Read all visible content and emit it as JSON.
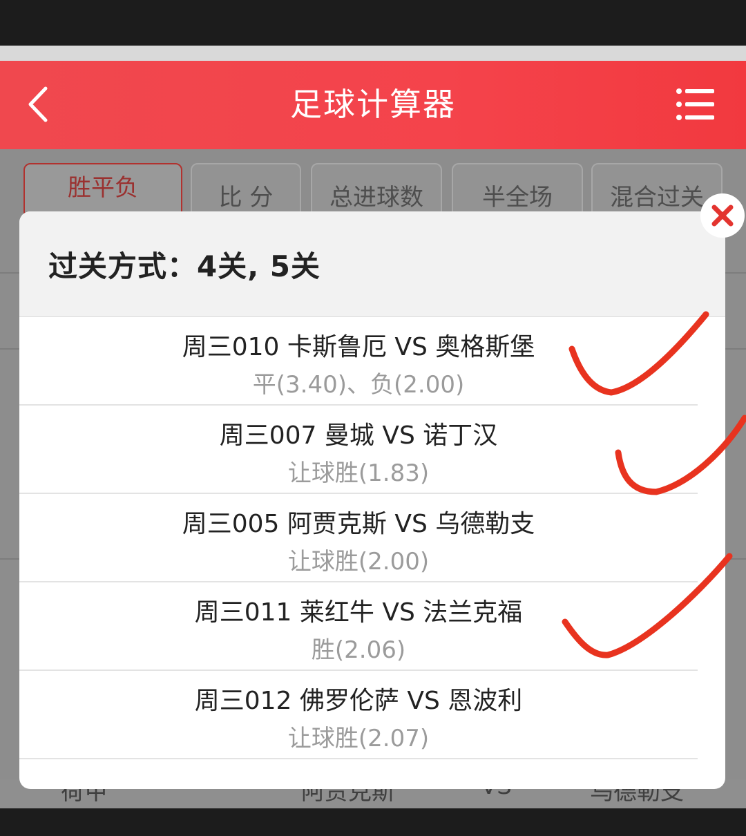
{
  "header": {
    "title": "足球计算器"
  },
  "tabs": [
    {
      "label": "胜平负",
      "active": true
    },
    {
      "label": "比 分"
    },
    {
      "label": "总进球数"
    },
    {
      "label": "半全场"
    },
    {
      "label": "混合过关"
    }
  ],
  "background_row": {
    "league": "荷甲",
    "home": "阿贾克斯",
    "vs": "VS",
    "away": "乌德勒支"
  },
  "modal": {
    "title": "过关方式：4关, 5关",
    "matches": [
      {
        "title": "周三010 卡斯鲁厄 VS 奥格斯堡",
        "odds": "平(3.40)、负(2.00)",
        "checked": true
      },
      {
        "title": "周三007 曼城 VS 诺丁汉",
        "odds": "让球胜(1.83)",
        "checked": true
      },
      {
        "title": "周三005 阿贾克斯 VS 乌德勒支",
        "odds": "让球胜(2.00)",
        "checked": false
      },
      {
        "title": "周三011 莱红牛 VS 法兰克福",
        "odds": "胜(2.06)",
        "checked": true
      },
      {
        "title": "周三012 佛罗伦萨 VS 恩波利",
        "odds": "让球胜(2.07)",
        "checked": false
      }
    ]
  },
  "colors": {
    "header_red": "#f2434b",
    "close_red": "#e3342f",
    "annotation_red": "#e8331f"
  },
  "icons": {
    "back": "chevron-left-icon",
    "menu": "list-menu-icon",
    "close": "close-icon",
    "check": "check-mark-annotation"
  }
}
